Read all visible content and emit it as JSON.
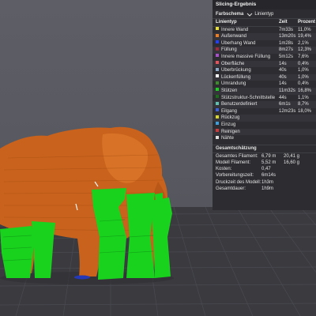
{
  "panel": {
    "title": "Slicing-Ergebnis",
    "scheme_label": "Farbschema",
    "scheme_value": "Linientyp",
    "columns": [
      "Linientyp",
      "Zeit",
      "Prozent"
    ],
    "rows": [
      {
        "name": "Innere Wand",
        "time": "7m33s",
        "percent": "11,0%",
        "color": "#e8e030"
      },
      {
        "name": "Außenwand",
        "time": "13m20s",
        "percent": "19,4%",
        "color": "#f07d1e"
      },
      {
        "name": "Überhang Wand",
        "time": "1m28s",
        "percent": "2,1%",
        "color": "#2040ff"
      },
      {
        "name": "Füllung",
        "time": "8m27s",
        "percent": "12,3%",
        "color": "#a0283a"
      },
      {
        "name": "Innere massive Füllung",
        "time": "5m12s",
        "percent": "7,6%",
        "color": "#a94fd0"
      },
      {
        "name": "Oberfläche",
        "time": "14s",
        "percent": "0,4%",
        "color": "#e8505a"
      },
      {
        "name": "Überbrückung",
        "time": "40s",
        "percent": "1,0%",
        "color": "#8aa8c8"
      },
      {
        "name": "Lückenfüllung",
        "time": "40s",
        "percent": "1,0%",
        "color": "#ffffff"
      },
      {
        "name": "Umrandung",
        "time": "14s",
        "percent": "0,4%",
        "color": "#3c8c2c"
      },
      {
        "name": "Stützen",
        "time": "11m32s",
        "percent": "16,8%",
        "color": "#19d21e"
      },
      {
        "name": "Stützstruktur-Schnittstelle",
        "time": "44s",
        "percent": "1,1%",
        "color": "#1a6b1a"
      },
      {
        "name": "Benutzerdefiniert",
        "time": "6m1s",
        "percent": "8,7%",
        "color": "#5ec2b0"
      },
      {
        "name": "Eilgang",
        "time": "12m23s",
        "percent": "18,0%",
        "color": "#3860e0"
      },
      {
        "name": "Rückzug",
        "time": "",
        "percent": "",
        "color": "#d8d82a"
      },
      {
        "name": "Einzug",
        "time": "",
        "percent": "",
        "color": "#3aa0e0"
      },
      {
        "name": "Reinigen",
        "time": "",
        "percent": "",
        "color": "#d03a3a"
      },
      {
        "name": "Nähte",
        "time": "",
        "percent": "",
        "color": "#e0e0e0"
      }
    ],
    "estimate_title": "Gesamtschätzung",
    "estimates": [
      {
        "label": "Gesamtes Filament:",
        "v1": "6,79 m",
        "v2": "20,41 g"
      },
      {
        "label": "Modell Filament:",
        "v1": "5,52 m",
        "v2": "16,60 g"
      },
      {
        "label": "Kosten:",
        "v1": "0,47",
        "v2": ""
      },
      {
        "label": "Vorbereitungszeit:",
        "v1": "6m14s",
        "v2": ""
      },
      {
        "label": "Druckzeit des Modell:",
        "v1": "1h3m",
        "v2": ""
      },
      {
        "label": "Gesamtdauer:",
        "v1": "1h9m",
        "v2": ""
      }
    ]
  },
  "viewport": {
    "model_color": "#d2691e",
    "support_color": "#19d21e",
    "bed_color": "#3a3a3f"
  }
}
